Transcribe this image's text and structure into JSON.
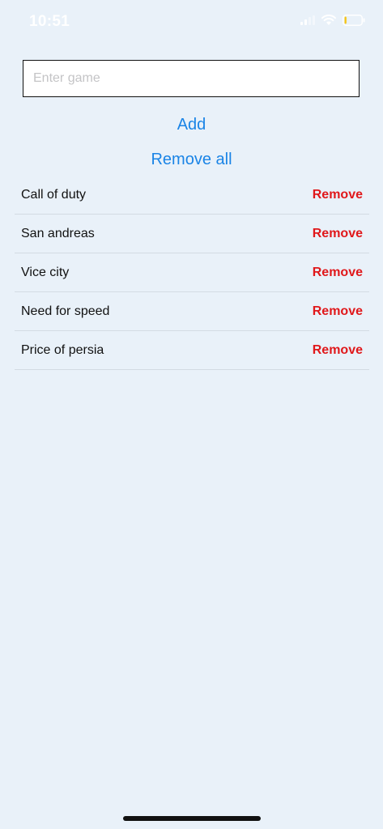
{
  "status_bar": {
    "time": "10:51",
    "icons": [
      "signal-icon",
      "wifi-icon",
      "battery-icon"
    ],
    "battery_color": "#f5c518",
    "battery_level": 0.12
  },
  "input": {
    "placeholder": "Enter game",
    "value": ""
  },
  "buttons": {
    "add_label": "Add",
    "remove_all_label": "Remove all"
  },
  "games": [
    {
      "name": "Call of duty",
      "action": "Remove"
    },
    {
      "name": "San andreas",
      "action": "Remove"
    },
    {
      "name": "Vice city",
      "action": "Remove"
    },
    {
      "name": "Need for speed",
      "action": "Remove"
    },
    {
      "name": "Price of persia",
      "action": "Remove"
    }
  ],
  "colors": {
    "background": "#e9f1f9",
    "accent": "#1a84e6",
    "danger": "#e0181b"
  }
}
